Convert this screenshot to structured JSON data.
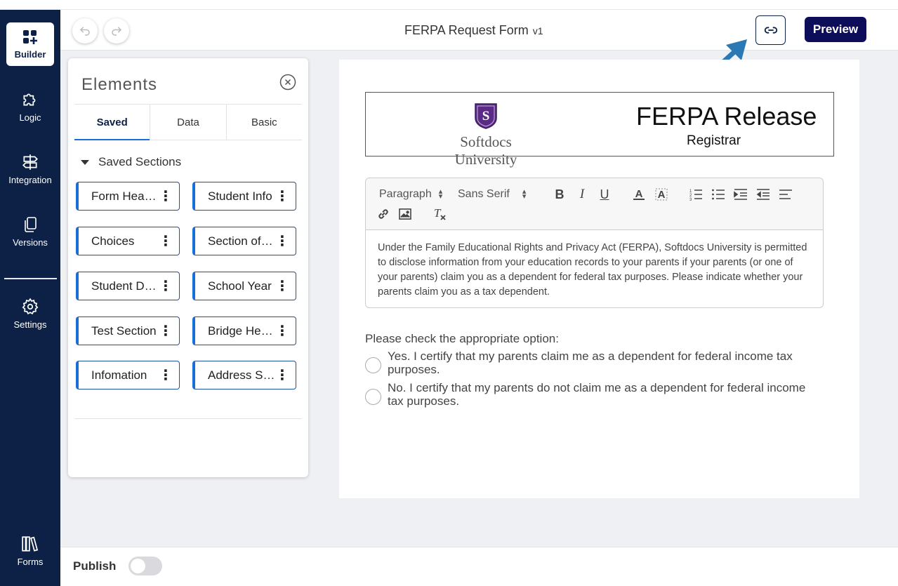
{
  "sidebar": {
    "items": [
      {
        "label": "Builder",
        "icon": "builder-icon"
      },
      {
        "label": "Logic",
        "icon": "puzzle-icon"
      },
      {
        "label": "Integration",
        "icon": "signpost-icon"
      },
      {
        "label": "Versions",
        "icon": "copy-icon"
      },
      {
        "label": "Settings",
        "icon": "gear-icon"
      },
      {
        "label": "Forms",
        "icon": "books-icon"
      }
    ]
  },
  "header": {
    "title": "FERPA Request Form",
    "version": "v1",
    "preview_label": "Preview",
    "link_icon": "link-icon",
    "undo_icon": "undo-icon",
    "redo_icon": "redo-icon"
  },
  "panel": {
    "title": "Elements",
    "tabs": [
      {
        "label": "Saved"
      },
      {
        "label": "Data"
      },
      {
        "label": "Basic"
      }
    ],
    "active_tab": "Saved",
    "section_label": "Saved Sections",
    "chips": [
      {
        "label": "Form Header"
      },
      {
        "label": "Student Info"
      },
      {
        "label": "Choices"
      },
      {
        "label": "Section of Form"
      },
      {
        "label": "Student Details"
      },
      {
        "label": "School Year"
      },
      {
        "label": "Test Section"
      },
      {
        "label": "Bridge Header"
      },
      {
        "label": "Infomation"
      },
      {
        "label": "Address Section"
      }
    ]
  },
  "canvas": {
    "logo_text": "Softdocs University",
    "header_title": "FERPA Release",
    "header_subtitle": "Registrar",
    "editor": {
      "format_select": "Paragraph",
      "font_select": "Sans Serif",
      "bold": "B",
      "italic": "I",
      "underline": "U",
      "body": "Under the Family Educational Rights and Privacy Act (FERPA), Softdocs University is permitted to disclose information from your education records to your parents if your parents (or one of your parents) claim you as a dependent for federal tax purposes. Please indicate whether your parents claim you as a tax dependent."
    },
    "question": "Please check the appropriate option:",
    "options": [
      {
        "label": "Yes. I certify that my parents claim me as a dependent for federal income tax purposes."
      },
      {
        "label": "No. I certify that my parents do not claim me as a dependent for federal income tax purposes."
      }
    ]
  },
  "footer": {
    "publish_label": "Publish",
    "publish_on": false
  },
  "colors": {
    "sidebar_bg": "#0d2147",
    "preview_bg": "#0d0d5a",
    "accent": "#1a6fd6",
    "arrow": "#2a78b4",
    "logo_purple": "#5b2a86"
  }
}
